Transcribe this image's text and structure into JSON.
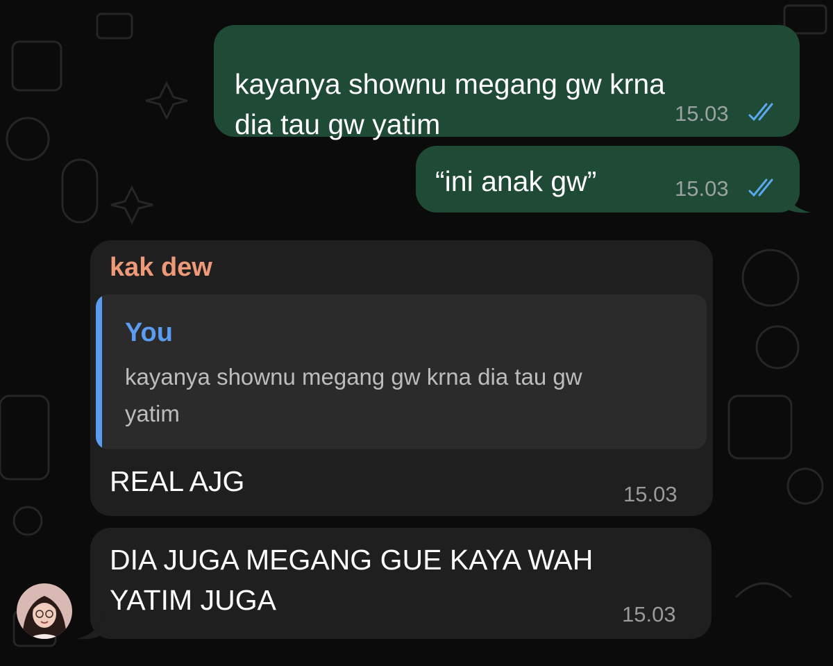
{
  "messages": [
    {
      "direction": "outgoing",
      "lines": [
        "kayanya shownu megang gw krna",
        "dia tau gw yatim"
      ],
      "time": "15.03",
      "status": "read"
    },
    {
      "direction": "outgoing",
      "lines": [
        "“ini anak gw”"
      ],
      "time": "15.03",
      "status": "read"
    },
    {
      "direction": "incoming",
      "sender": "kak dew",
      "reply": {
        "author": "You",
        "lines": [
          "kayanya shownu megang gw krna dia tau gw",
          "yatim"
        ]
      },
      "lines": [
        "REAL AJG"
      ],
      "time": "15.03"
    },
    {
      "direction": "incoming",
      "lines": [
        "DIA JUGA MEGANG GUE KAYA WAH",
        "YATIM JUGA"
      ],
      "time": "15.03"
    }
  ],
  "colors": {
    "outgoing_bubble": "#1f4a36",
    "incoming_bubble": "#1f1f1f",
    "read_ticks": "#5aa8f0",
    "sender_name": "#ee9a78",
    "reply_accent": "#5a9cf0"
  },
  "icons": {
    "read_receipt": "double-check-icon",
    "avatar": "contact-avatar"
  }
}
